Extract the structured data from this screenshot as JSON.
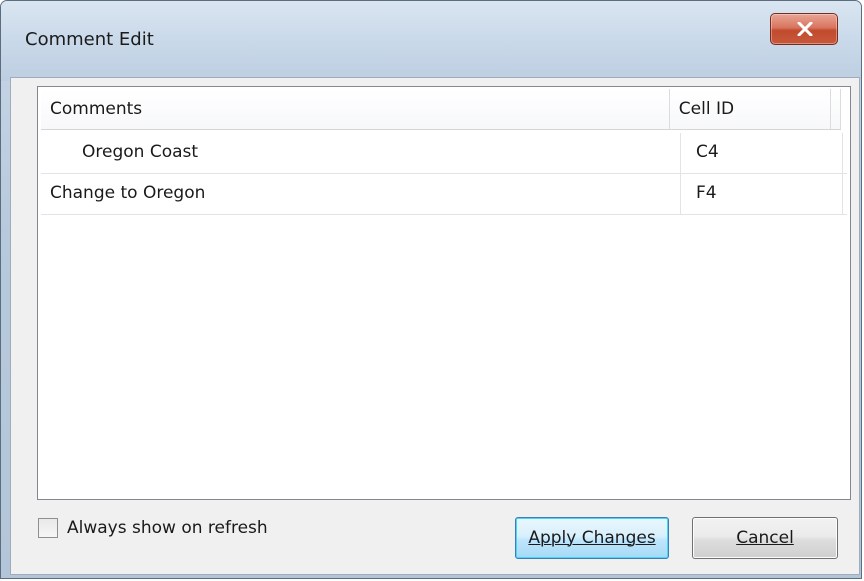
{
  "window": {
    "title": "Comment Edit"
  },
  "grid": {
    "columns": [
      "Comments",
      "Cell ID"
    ],
    "rows": [
      {
        "comment": "Oregon Coast",
        "cell_id": "C4"
      },
      {
        "comment": "Change to Oregon",
        "cell_id": "F4"
      }
    ]
  },
  "options": {
    "always_show_label": "Always show on refresh",
    "always_show_checked": false
  },
  "buttons": {
    "apply_label": "Apply Changes",
    "cancel_label": "Cancel"
  },
  "icons": {
    "close": "close-icon"
  },
  "colors": {
    "close_button": "#c8593b",
    "default_button_border": "#3c7fb1"
  }
}
